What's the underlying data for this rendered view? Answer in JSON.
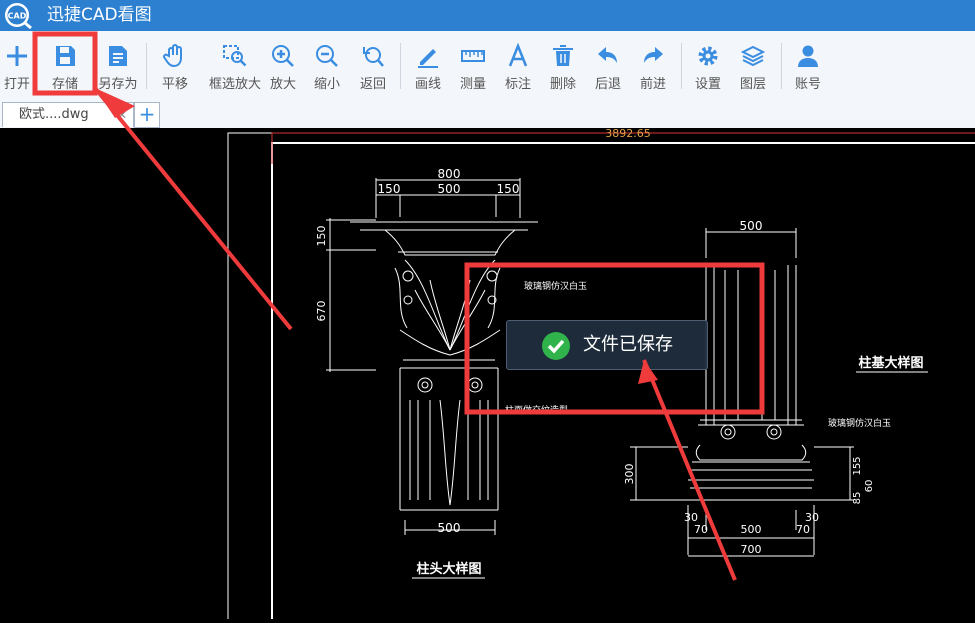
{
  "app": {
    "title": "迅捷CAD看图",
    "logo_text": "CAD"
  },
  "toolbar": {
    "open": "打开",
    "save": "存储",
    "save_as": "另存为",
    "pan": "平移",
    "window_zoom": "框选放大",
    "zoom_in": "放大",
    "zoom_out": "缩小",
    "back": "返回",
    "line": "画线",
    "measure": "测量",
    "annotate": "标注",
    "delete": "删除",
    "undo": "后退",
    "redo": "前进",
    "settings": "设置",
    "layers": "图层",
    "account": "账号"
  },
  "tabs": {
    "file_name": "欧式....dwg",
    "close": "✕",
    "add": "+"
  },
  "toast": {
    "message": "文件已保存"
  },
  "drawing": {
    "top_dimension": "3892.65",
    "capital_width": "800",
    "capital_parts": [
      "150",
      "500",
      "150"
    ],
    "capital_heights": [
      "150",
      "670"
    ],
    "capital_note": "玻璃钢仿汉白玉",
    "capital_shaft_note": "柱面做交纹造型",
    "capital_bottom_width": "500",
    "capital_caption": "柱头大样图",
    "base_top_width": "500",
    "base_note": "玻璃钢仿汉白玉",
    "base_caption": "柱基大样图",
    "base_height_left": "300",
    "base_heights_right": [
      "155",
      "60",
      "85"
    ],
    "base_bottom_parts": [
      "30",
      "70",
      "500",
      "70",
      "30"
    ],
    "base_total_width": "700"
  },
  "colors": {
    "titlebar": "#2d7fd0",
    "icon_blue": "#3a8de0",
    "highlight_red": "#ef3b3b",
    "dimension_orange": "#e2a24a"
  }
}
